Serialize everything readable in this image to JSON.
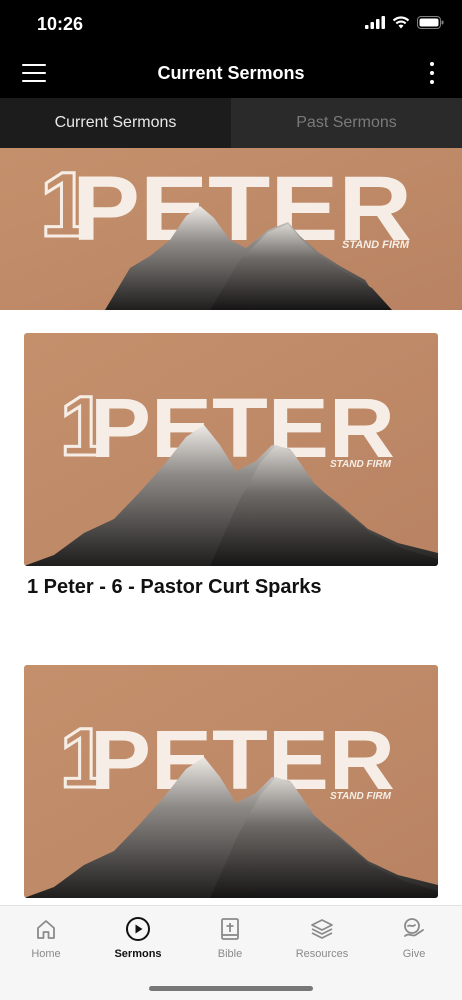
{
  "status_bar": {
    "time": "10:26"
  },
  "app_bar": {
    "title": "Current Sermons"
  },
  "tabs": [
    {
      "label": "Current Sermons",
      "active": true
    },
    {
      "label": "Past Sermons",
      "active": false
    }
  ],
  "series_art": {
    "number": "1",
    "title": "PETER",
    "tagline": "STAND FIRM",
    "background_color": "#C08A66",
    "text_color": "#F6EEE6"
  },
  "sermons": [
    {
      "title": "1 Peter - 6 - Pastor Curt Sparks"
    },
    {
      "title": ""
    }
  ],
  "bottom_nav": [
    {
      "label": "Home",
      "icon": "home-icon",
      "active": false
    },
    {
      "label": "Sermons",
      "icon": "play-circle-icon",
      "active": true
    },
    {
      "label": "Bible",
      "icon": "bible-icon",
      "active": false
    },
    {
      "label": "Resources",
      "icon": "layers-icon",
      "active": false
    },
    {
      "label": "Give",
      "icon": "give-icon",
      "active": false
    }
  ]
}
